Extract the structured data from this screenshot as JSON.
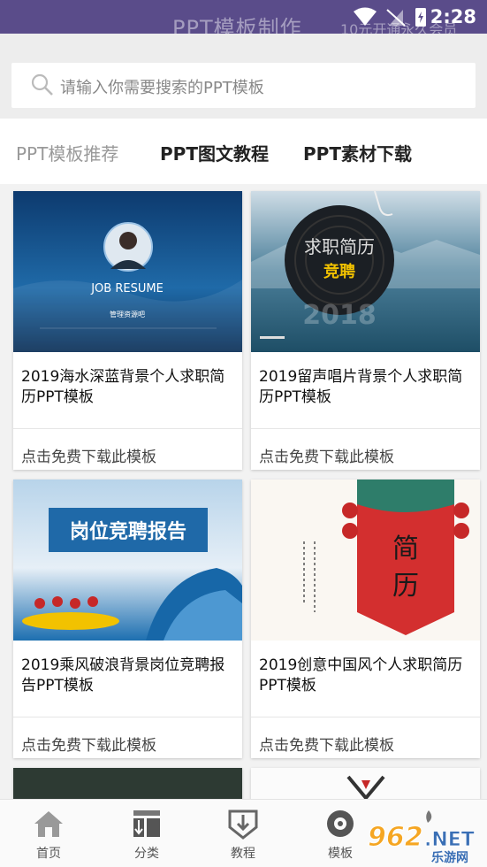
{
  "status": {
    "time": "2:28",
    "app_title": "PPT模板制作",
    "vip_text": "10元开通永久会员"
  },
  "search": {
    "placeholder": "请输入你需要搜索的PPT模板"
  },
  "tabs": [
    {
      "label": "PPT模板推荐"
    },
    {
      "label": "PPT图文教程"
    },
    {
      "label": "PPT素材下载"
    }
  ],
  "cards": [
    {
      "title": "2019海水深蓝背景个人求职简历PPT模板",
      "download": "点击免费下载此模板",
      "thumb": {
        "heading": "JOB RESUME",
        "sub": "管理资源吧"
      }
    },
    {
      "title": "2019留声唱片背景个人求职简历PPT模板",
      "download": "点击免费下载此模板",
      "thumb": {
        "heading": "求职简历",
        "sub": "竞聘",
        "year": "2018"
      }
    },
    {
      "title": "2019乘风破浪背景岗位竞聘报告PPT模板",
      "download": "点击免费下载此模板",
      "thumb": {
        "heading": "岗位竞聘报告"
      }
    },
    {
      "title": "2019创意中国风个人求职简历PPT模板",
      "download": "点击免费下载此模板",
      "thumb": {
        "heading": "简",
        "sub": "历"
      }
    }
  ],
  "bottom_nav": [
    {
      "label": "首页",
      "icon": "home-icon"
    },
    {
      "label": "分类",
      "icon": "category-icon"
    },
    {
      "label": "教程",
      "icon": "tutorial-icon"
    },
    {
      "label": "模板",
      "icon": "template-icon"
    }
  ],
  "watermark": {
    "text": "962.NET",
    "sub": "乐游网"
  }
}
